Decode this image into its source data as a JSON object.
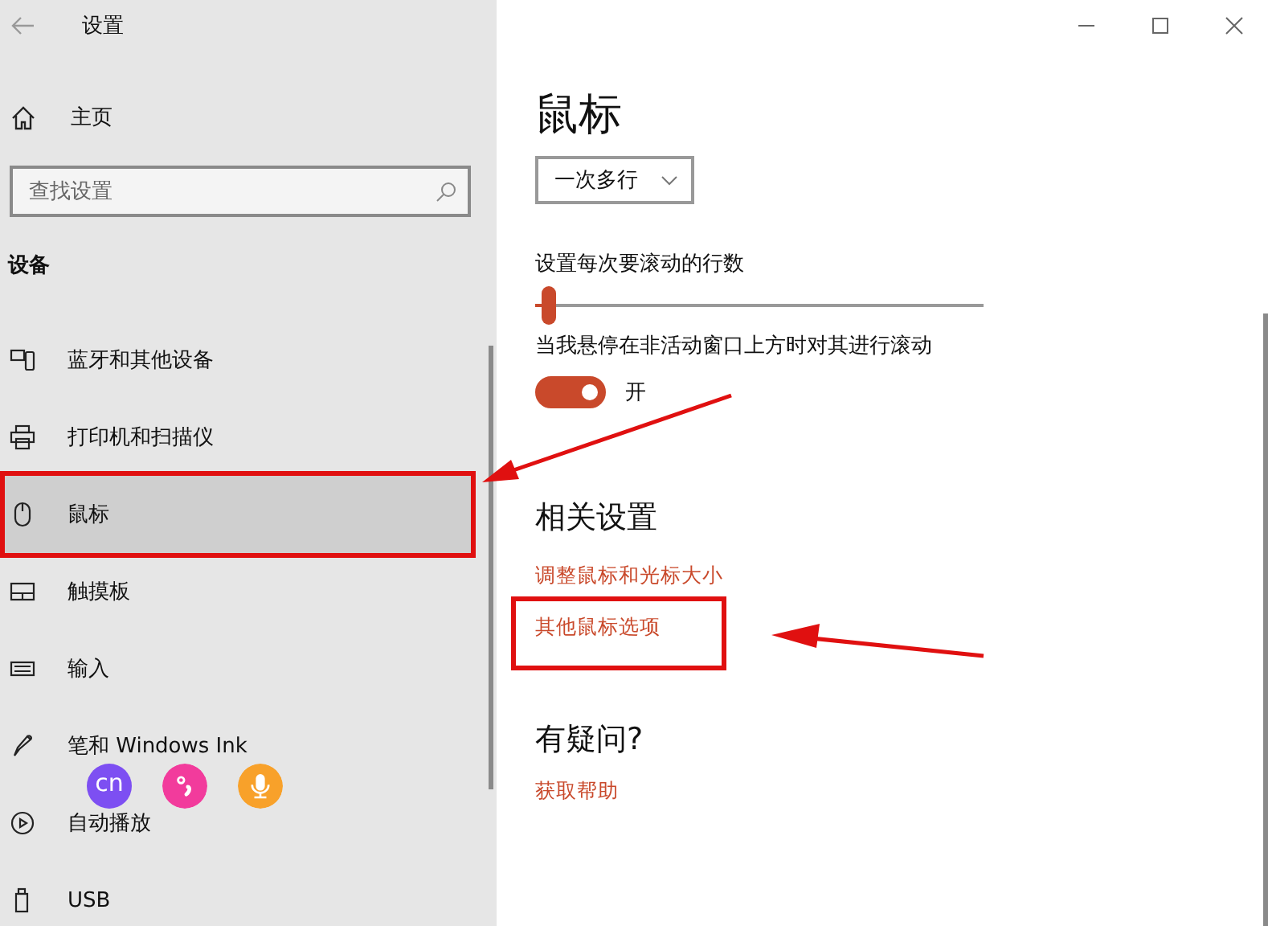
{
  "window": {
    "title": "设置"
  },
  "sidebar": {
    "home": "主页",
    "search": {
      "placeholder": "查找设置"
    },
    "section": "设备",
    "items": [
      {
        "label": "蓝牙和其他设备",
        "selected": false,
        "highlighted": false
      },
      {
        "label": "打印机和扫描仪",
        "selected": false,
        "highlighted": false
      },
      {
        "label": "鼠标",
        "selected": true,
        "highlighted": true
      },
      {
        "label": "触摸板",
        "selected": false,
        "highlighted": false
      },
      {
        "label": "输入",
        "selected": false,
        "highlighted": false
      },
      {
        "label": "笔和 Windows Ink",
        "selected": false,
        "highlighted": false
      },
      {
        "label": "自动播放",
        "selected": false,
        "highlighted": false
      },
      {
        "label": "USB",
        "selected": false,
        "highlighted": false
      }
    ]
  },
  "ime_toolbar": {
    "language": "cn"
  },
  "content": {
    "title": "鼠标",
    "scroll_dropdown": {
      "value": "一次多行"
    },
    "lines_slider": {
      "label": "设置每次要滚动的行数",
      "level": 0.03
    },
    "inactive_scroll": {
      "label": "当我悬停在非活动窗口上方时对其进行滚动",
      "on": true,
      "state": "开"
    },
    "related": {
      "heading": "相关设置",
      "links": [
        {
          "label": "调整鼠标和光标大小",
          "highlighted": false
        },
        {
          "label": "其他鼠标选项",
          "highlighted": true
        }
      ]
    },
    "help": {
      "heading": "有疑问?",
      "link": "获取帮助"
    }
  }
}
